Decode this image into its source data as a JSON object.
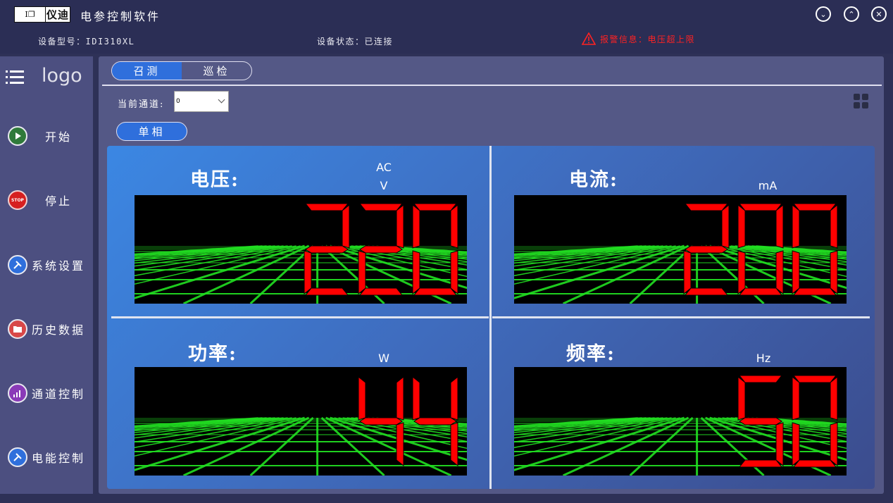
{
  "app": {
    "logo_glyph": "I❐",
    "logo_text": "仪迪",
    "title": "电参控制软件"
  },
  "window_controls": {
    "minimize": "⌄",
    "maximize": "⌃",
    "close": "✕"
  },
  "status": {
    "model": "设备型号：IDI310XL",
    "connection": "设备状态：已连接",
    "alarm": "报警信息：电压超上限"
  },
  "sidebar": {
    "logo": "logo",
    "items": [
      {
        "label": "开始",
        "icon": "play-icon"
      },
      {
        "label": "停止",
        "icon": "stop-icon"
      },
      {
        "label": "系统设置",
        "icon": "wrench-icon"
      },
      {
        "label": "历史数据",
        "icon": "folder-icon"
      },
      {
        "label": "通道控制",
        "icon": "signal-icon"
      },
      {
        "label": "电能控制",
        "icon": "wrench-icon"
      }
    ]
  },
  "tabs": [
    {
      "label": "召测",
      "active": true
    },
    {
      "label": "巡检",
      "active": false
    }
  ],
  "channel": {
    "label": "当前通道:",
    "value": "0"
  },
  "phase_button": "单相",
  "meters": [
    {
      "title": "电压:",
      "unit_top": "AC",
      "unit": "V",
      "value": "220"
    },
    {
      "title": "电流:",
      "unit_top": "",
      "unit": "mA",
      "value": "200"
    },
    {
      "title": "功率:",
      "unit_top": "",
      "unit": "W",
      "value": "44"
    },
    {
      "title": "频率:",
      "unit_top": "",
      "unit": "Hz",
      "value": "50"
    }
  ],
  "colors": {
    "accent": "#2f6fdc",
    "digit": "#ff0000",
    "grid": "#22e022",
    "alarm": "#ff2222"
  }
}
